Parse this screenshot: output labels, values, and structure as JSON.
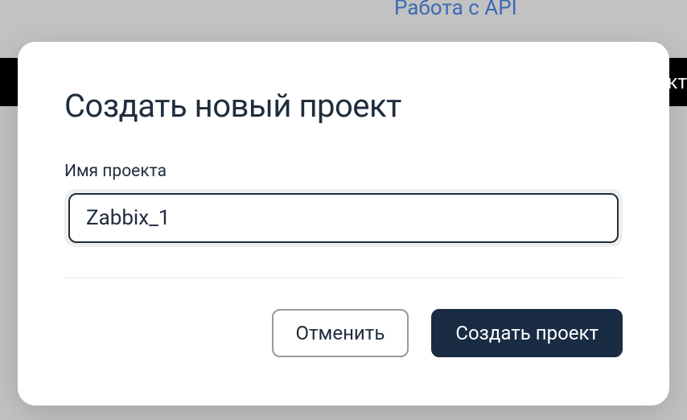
{
  "background": {
    "top_link": "Работа с API",
    "blackbar_fragment": "ект"
  },
  "modal": {
    "title": "Создать новый проект",
    "field_label": "Имя проекта",
    "project_name_value": "Zabbix_1",
    "cancel_label": "Отменить",
    "submit_label": "Создать проект"
  }
}
